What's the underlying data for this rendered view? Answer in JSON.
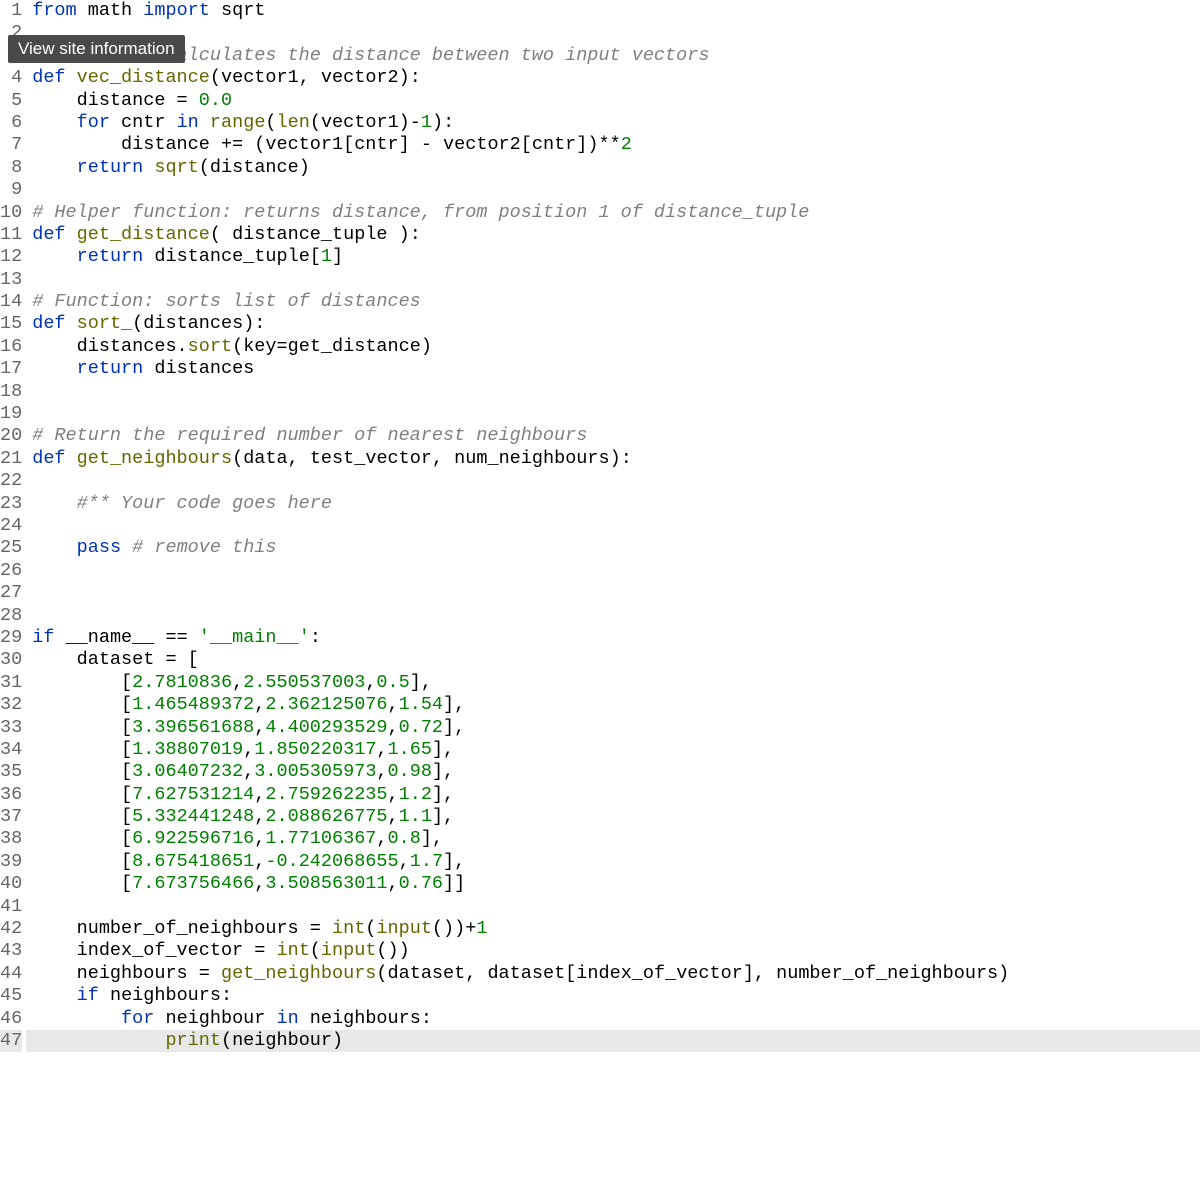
{
  "tooltip": "View site information",
  "line_count": 47,
  "current_line": 47,
  "code_lines": [
    [
      [
        "kw",
        "from"
      ],
      [
        "id",
        " math "
      ],
      [
        "kw",
        "import"
      ],
      [
        "id",
        " sqrt"
      ]
    ],
    [],
    [
      [
        "cm",
        "# Function: calculates the distance between two input vectors"
      ]
    ],
    [
      [
        "kw",
        "def"
      ],
      [
        "id",
        " "
      ],
      [
        "fn",
        "vec_distance"
      ],
      [
        "op",
        "("
      ],
      [
        "id",
        "vector1"
      ],
      [
        "op",
        ", "
      ],
      [
        "id",
        "vector2"
      ],
      [
        "op",
        "):"
      ]
    ],
    [
      [
        "id",
        "    distance "
      ],
      [
        "op",
        "= "
      ],
      [
        "num",
        "0.0"
      ]
    ],
    [
      [
        "id",
        "    "
      ],
      [
        "kw",
        "for"
      ],
      [
        "id",
        " cntr "
      ],
      [
        "kw",
        "in"
      ],
      [
        "id",
        " "
      ],
      [
        "builtin",
        "range"
      ],
      [
        "op",
        "("
      ],
      [
        "builtin",
        "len"
      ],
      [
        "op",
        "("
      ],
      [
        "id",
        "vector1"
      ],
      [
        "op",
        ")"
      ],
      [
        "op",
        "-"
      ],
      [
        "num",
        "1"
      ],
      [
        "op",
        "):"
      ]
    ],
    [
      [
        "id",
        "        distance "
      ],
      [
        "op",
        "+= ("
      ],
      [
        "id",
        "vector1"
      ],
      [
        "op",
        "["
      ],
      [
        "id",
        "cntr"
      ],
      [
        "op",
        "] - "
      ],
      [
        "id",
        "vector2"
      ],
      [
        "op",
        "["
      ],
      [
        "id",
        "cntr"
      ],
      [
        "op",
        "])**"
      ],
      [
        "num",
        "2"
      ]
    ],
    [
      [
        "id",
        "    "
      ],
      [
        "kw",
        "return"
      ],
      [
        "id",
        " "
      ],
      [
        "builtin",
        "sqrt"
      ],
      [
        "op",
        "("
      ],
      [
        "id",
        "distance"
      ],
      [
        "op",
        ")"
      ]
    ],
    [],
    [
      [
        "cm",
        "# Helper function: returns distance, from position 1 of distance_tuple"
      ]
    ],
    [
      [
        "kw",
        "def"
      ],
      [
        "id",
        " "
      ],
      [
        "fn",
        "get_distance"
      ],
      [
        "op",
        "( "
      ],
      [
        "id",
        "distance_tuple"
      ],
      [
        "op",
        " ):"
      ]
    ],
    [
      [
        "id",
        "    "
      ],
      [
        "kw",
        "return"
      ],
      [
        "id",
        " distance_tuple"
      ],
      [
        "op",
        "["
      ],
      [
        "num",
        "1"
      ],
      [
        "op",
        "]"
      ]
    ],
    [],
    [
      [
        "cm",
        "# Function: sorts list of distances"
      ]
    ],
    [
      [
        "kw",
        "def"
      ],
      [
        "id",
        " "
      ],
      [
        "fn",
        "sort_"
      ],
      [
        "op",
        "("
      ],
      [
        "id",
        "distances"
      ],
      [
        "op",
        "):"
      ]
    ],
    [
      [
        "id",
        "    distances"
      ],
      [
        "op",
        "."
      ],
      [
        "builtin",
        "sort"
      ],
      [
        "op",
        "("
      ],
      [
        "id",
        "key"
      ],
      [
        "op",
        "="
      ],
      [
        "id",
        "get_distance"
      ],
      [
        "op",
        ")"
      ]
    ],
    [
      [
        "id",
        "    "
      ],
      [
        "kw",
        "return"
      ],
      [
        "id",
        " distances"
      ]
    ],
    [],
    [],
    [
      [
        "cm",
        "# Return the required number of nearest neighbours"
      ]
    ],
    [
      [
        "kw",
        "def"
      ],
      [
        "id",
        " "
      ],
      [
        "fn",
        "get_neighbours"
      ],
      [
        "op",
        "("
      ],
      [
        "id",
        "data"
      ],
      [
        "op",
        ", "
      ],
      [
        "id",
        "test_vector"
      ],
      [
        "op",
        ", "
      ],
      [
        "id",
        "num_neighbours"
      ],
      [
        "op",
        "):"
      ]
    ],
    [],
    [
      [
        "id",
        "    "
      ],
      [
        "cm",
        "#** Your code goes here"
      ]
    ],
    [],
    [
      [
        "id",
        "    "
      ],
      [
        "kw",
        "pass"
      ],
      [
        "id",
        " "
      ],
      [
        "cm",
        "# remove this"
      ]
    ],
    [],
    [],
    [],
    [
      [
        "kw",
        "if"
      ],
      [
        "id",
        " __name__ "
      ],
      [
        "op",
        "== "
      ],
      [
        "str",
        "'__main__'"
      ],
      [
        "op",
        ":"
      ]
    ],
    [
      [
        "id",
        "    dataset "
      ],
      [
        "op",
        "= ["
      ]
    ],
    [
      [
        "id",
        "        "
      ],
      [
        "op",
        "["
      ],
      [
        "num",
        "2.7810836"
      ],
      [
        "op",
        ","
      ],
      [
        "num",
        "2.550537003"
      ],
      [
        "op",
        ","
      ],
      [
        "num",
        "0.5"
      ],
      [
        "op",
        "],"
      ]
    ],
    [
      [
        "id",
        "        "
      ],
      [
        "op",
        "["
      ],
      [
        "num",
        "1.465489372"
      ],
      [
        "op",
        ","
      ],
      [
        "num",
        "2.362125076"
      ],
      [
        "op",
        ","
      ],
      [
        "num",
        "1.54"
      ],
      [
        "op",
        "],"
      ]
    ],
    [
      [
        "id",
        "        "
      ],
      [
        "op",
        "["
      ],
      [
        "num",
        "3.396561688"
      ],
      [
        "op",
        ","
      ],
      [
        "num",
        "4.400293529"
      ],
      [
        "op",
        ","
      ],
      [
        "num",
        "0.72"
      ],
      [
        "op",
        "],"
      ]
    ],
    [
      [
        "id",
        "        "
      ],
      [
        "op",
        "["
      ],
      [
        "num",
        "1.38807019"
      ],
      [
        "op",
        ","
      ],
      [
        "num",
        "1.850220317"
      ],
      [
        "op",
        ","
      ],
      [
        "num",
        "1.65"
      ],
      [
        "op",
        "],"
      ]
    ],
    [
      [
        "id",
        "        "
      ],
      [
        "op",
        "["
      ],
      [
        "num",
        "3.06407232"
      ],
      [
        "op",
        ","
      ],
      [
        "num",
        "3.005305973"
      ],
      [
        "op",
        ","
      ],
      [
        "num",
        "0.98"
      ],
      [
        "op",
        "],"
      ]
    ],
    [
      [
        "id",
        "        "
      ],
      [
        "op",
        "["
      ],
      [
        "num",
        "7.627531214"
      ],
      [
        "op",
        ","
      ],
      [
        "num",
        "2.759262235"
      ],
      [
        "op",
        ","
      ],
      [
        "num",
        "1.2"
      ],
      [
        "op",
        "],"
      ]
    ],
    [
      [
        "id",
        "        "
      ],
      [
        "op",
        "["
      ],
      [
        "num",
        "5.332441248"
      ],
      [
        "op",
        ","
      ],
      [
        "num",
        "2.088626775"
      ],
      [
        "op",
        ","
      ],
      [
        "num",
        "1.1"
      ],
      [
        "op",
        "],"
      ]
    ],
    [
      [
        "id",
        "        "
      ],
      [
        "op",
        "["
      ],
      [
        "num",
        "6.922596716"
      ],
      [
        "op",
        ","
      ],
      [
        "num",
        "1.77106367"
      ],
      [
        "op",
        ","
      ],
      [
        "num",
        "0.8"
      ],
      [
        "op",
        "],"
      ]
    ],
    [
      [
        "id",
        "        "
      ],
      [
        "op",
        "["
      ],
      [
        "num",
        "8.675418651"
      ],
      [
        "op",
        ","
      ],
      [
        "num",
        "-0.242068655"
      ],
      [
        "op",
        ","
      ],
      [
        "num",
        "1.7"
      ],
      [
        "op",
        "],"
      ]
    ],
    [
      [
        "id",
        "        "
      ],
      [
        "op",
        "["
      ],
      [
        "num",
        "7.673756466"
      ],
      [
        "op",
        ","
      ],
      [
        "num",
        "3.508563011"
      ],
      [
        "op",
        ","
      ],
      [
        "num",
        "0.76"
      ],
      [
        "op",
        "]]"
      ]
    ],
    [],
    [
      [
        "id",
        "    number_of_neighbours "
      ],
      [
        "op",
        "= "
      ],
      [
        "builtin",
        "int"
      ],
      [
        "op",
        "("
      ],
      [
        "builtin",
        "input"
      ],
      [
        "op",
        "())+"
      ],
      [
        "num",
        "1"
      ]
    ],
    [
      [
        "id",
        "    index_of_vector "
      ],
      [
        "op",
        "= "
      ],
      [
        "builtin",
        "int"
      ],
      [
        "op",
        "("
      ],
      [
        "builtin",
        "input"
      ],
      [
        "op",
        "())"
      ]
    ],
    [
      [
        "id",
        "    neighbours "
      ],
      [
        "op",
        "= "
      ],
      [
        "fn",
        "get_neighbours"
      ],
      [
        "op",
        "("
      ],
      [
        "id",
        "dataset"
      ],
      [
        "op",
        ", "
      ],
      [
        "id",
        "dataset"
      ],
      [
        "op",
        "["
      ],
      [
        "id",
        "index_of_vector"
      ],
      [
        "op",
        "], "
      ],
      [
        "id",
        "number_of_neighbours"
      ],
      [
        "op",
        ")"
      ]
    ],
    [
      [
        "id",
        "    "
      ],
      [
        "kw",
        "if"
      ],
      [
        "id",
        " neighbours"
      ],
      [
        "op",
        ":"
      ]
    ],
    [
      [
        "id",
        "        "
      ],
      [
        "kw",
        "for"
      ],
      [
        "id",
        " neighbour "
      ],
      [
        "kw",
        "in"
      ],
      [
        "id",
        " neighbours"
      ],
      [
        "op",
        ":"
      ]
    ],
    [
      [
        "id",
        "            "
      ],
      [
        "builtin",
        "print"
      ],
      [
        "op",
        "("
      ],
      [
        "id",
        "neighbour"
      ],
      [
        "op",
        ")"
      ]
    ]
  ]
}
